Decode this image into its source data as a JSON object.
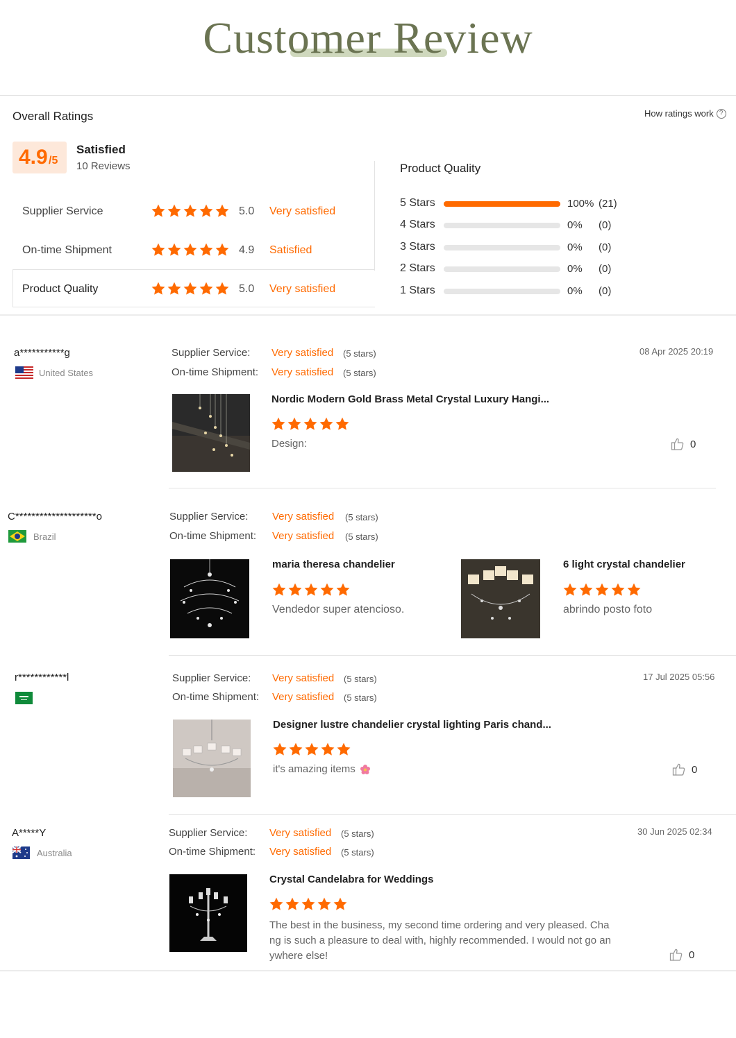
{
  "header": {
    "title": "Customer Review"
  },
  "overall": {
    "heading": "Overall Ratings",
    "how_link": "How ratings work",
    "score": "4.9",
    "score_suffix": "/5",
    "status": "Satisfied",
    "reviews": "10 Reviews",
    "rows": [
      {
        "label": "Supplier Service",
        "rating": 5,
        "value": "5.0",
        "text": "Very satisfied"
      },
      {
        "label": "On-time Shipment",
        "rating": 5,
        "value": "4.9",
        "text": "Satisfied"
      },
      {
        "label": "Product Quality",
        "rating": 5,
        "value": "5.0",
        "text": "Very satisfied"
      }
    ]
  },
  "quality": {
    "heading": "Product Quality",
    "rows": [
      {
        "label": "5 Stars",
        "fraction": 1.0,
        "pct": "100%",
        "count": "(21)"
      },
      {
        "label": "4 Stars",
        "fraction": 0,
        "pct": "0%",
        "count": "(0)"
      },
      {
        "label": "3 Stars",
        "fraction": 0,
        "pct": "0%",
        "count": "(0)"
      },
      {
        "label": "2 Stars",
        "fraction": 0,
        "pct": "0%",
        "count": "(0)"
      },
      {
        "label": "1 Stars",
        "fraction": 0,
        "pct": "0%",
        "count": "(0)"
      }
    ]
  },
  "labels": {
    "supplier": "Supplier Service:",
    "shipment": "On-time Shipment:",
    "very_satisfied": "Very satisfied",
    "five_stars": "(5 stars)"
  },
  "reviews": [
    {
      "user": "a***********g",
      "country": "United States",
      "date": "08 Apr 2025 20:19",
      "product": "Nordic Modern Gold Brass Metal Crystal Luxury Hangi...",
      "rating": 5,
      "comment": "Design:",
      "likes": "0"
    },
    {
      "user": "C********************o",
      "country": "Brazil",
      "products": [
        {
          "name": "maria theresa chandelier",
          "rating": 5,
          "comment": "Vendedor super atencioso."
        },
        {
          "name": "6 light crystal chandelier",
          "rating": 5,
          "comment": "abrindo posto foto"
        }
      ]
    },
    {
      "user": "r************l",
      "country": "",
      "date": "17 Jul 2025 05:56",
      "product": "Designer lustre chandelier crystal lighting Paris chand...",
      "rating": 5,
      "comment": "it's amazing items",
      "likes": "0"
    },
    {
      "user": "A*****Y",
      "country": "Australia",
      "date": "30 Jun 2025 02:34",
      "product": "Crystal Candelabra for Weddings",
      "rating": 5,
      "comment_lines": [
        "The best in the business, my second time ordering and very pleased. Cha",
        "ng is such a pleasure to deal with, highly recommended. I would not go an",
        "ywhere else!"
      ],
      "likes": "0"
    }
  ],
  "colors": {
    "accent": "#ff6a00",
    "title": "#6b7452",
    "score_bg": "#fde8da"
  }
}
